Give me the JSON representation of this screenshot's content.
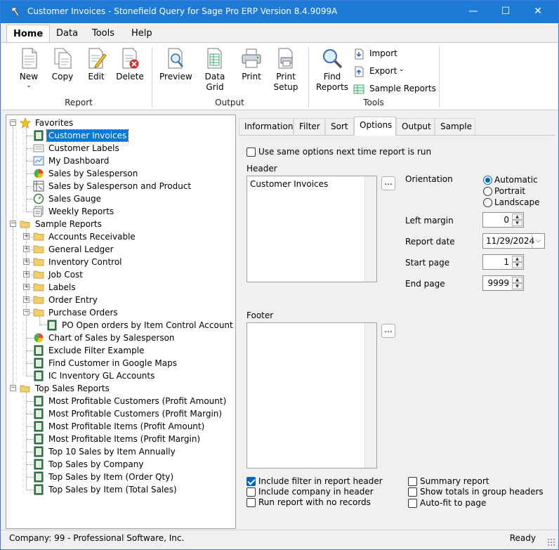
{
  "window": {
    "title": "Customer Invoices - Stonefield Query for Sage Pro ERP Version 8.4.9099A",
    "minimize": "—",
    "maximize": "☐",
    "close": "✕"
  },
  "ribbon": {
    "tabs": [
      "Home",
      "Data",
      "Tools",
      "Help"
    ],
    "report_group": {
      "label": "Report",
      "new": "New",
      "copy": "Copy",
      "edit": "Edit",
      "delete": "Delete"
    },
    "output_group": {
      "label": "Output",
      "preview": "Preview",
      "data_grid": "Data Grid",
      "print": "Print",
      "print_setup_1": "Print",
      "print_setup_2": "Setup"
    },
    "tools_group": {
      "label": "Tools",
      "find_reports_1": "Find",
      "find_reports_2": "Reports",
      "import": "Import",
      "export": "Export",
      "sample_reports": "Sample Reports"
    }
  },
  "tree": {
    "favorites": {
      "label": "Favorites",
      "items": [
        "Customer Invoices",
        "Customer Labels",
        "My Dashboard",
        "Sales by Salesperson",
        "Sales by Salesperson and Product",
        "Sales Gauge",
        "Weekly Reports"
      ]
    },
    "sample_reports": {
      "label": "Sample Reports",
      "folders": [
        "Accounts Receivable",
        "General Ledger",
        "Inventory Control",
        "Job Cost",
        "Labels",
        "Order Entry",
        "Purchase Orders"
      ],
      "po_child": "PO Open orders by Item Control Account",
      "items": [
        "Chart of Sales by Salesperson",
        "Exclude Filter Example",
        "Find Customer in Google Maps",
        "IC Inventory GL Accounts"
      ]
    },
    "top_sales": {
      "label": "Top Sales Reports",
      "items": [
        "Most Profitable Customers (Profit Amount)",
        "Most Profitable Customers (Profit Margin)",
        "Most Profitable Items (Profit Amount)",
        "Most Profitable Items (Profit Margin)",
        "Top 10 Sales by Item Annually",
        "Top Sales by Company",
        "Top Sales by Item (Order Qty)",
        "Top Sales by Item (Total Sales)"
      ]
    }
  },
  "tabs": [
    "Information",
    "Filter",
    "Sort",
    "Options",
    "Output",
    "Sample"
  ],
  "options": {
    "same_options": "Use same options next time report is run",
    "header_label": "Header",
    "header_text": "Customer Invoices",
    "footer_label": "Footer",
    "footer_text": "",
    "ellipsis": "...",
    "orientation_label": "Orientation",
    "orientation": [
      "Automatic",
      "Portrait",
      "Landscape"
    ],
    "left_margin_label": "Left margin",
    "left_margin": "0",
    "report_date_label": "Report date",
    "report_date": "11/29/2024",
    "start_page_label": "Start page",
    "start_page": "1",
    "end_page_label": "End page",
    "end_page": "9999",
    "include_filter": "Include filter in report header",
    "include_company": "Include company in header",
    "run_no_records": "Run report with no records",
    "summary_report": "Summary report",
    "show_totals": "Show totals in group headers",
    "auto_fit": "Auto-fit to page"
  },
  "status": {
    "company": "Company: 99 - Professional Software, Inc.",
    "state": "Ready"
  },
  "colors": {
    "titlebar": "#1d7bd6",
    "selection": "#0078d7",
    "check": "#0067c0"
  }
}
